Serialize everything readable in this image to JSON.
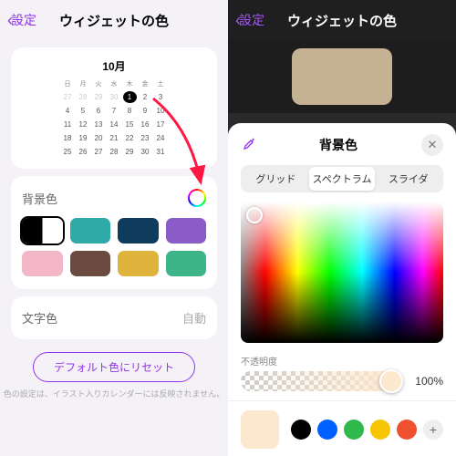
{
  "left": {
    "back": "設定",
    "title": "ウィジェットの色",
    "calendar": {
      "month": "10月",
      "dow": [
        "日",
        "月",
        "火",
        "水",
        "木",
        "金",
        "土"
      ],
      "prevDays": [
        27,
        28,
        29,
        30
      ],
      "days": [
        1,
        2,
        3,
        4,
        5,
        6,
        7,
        8,
        9,
        10,
        11,
        12,
        13,
        14,
        15,
        16,
        17,
        18,
        19,
        20,
        21,
        22,
        23,
        24,
        25,
        26,
        27,
        28,
        29,
        30,
        31
      ],
      "today": 1
    },
    "bgSection": {
      "title": "背景色"
    },
    "swatches": [
      "#30a9a9",
      "#0f3b5c",
      "#8b5cc7",
      "#f2b6c6",
      "#6b4a3f",
      "#e0b33c",
      "#3eb489"
    ],
    "textSection": {
      "title": "文字色",
      "value": "自動"
    },
    "reset": "デフォルト色にリセット",
    "note": "色の設定は、イラスト入りカレンダーには反映されません。"
  },
  "right": {
    "back": "設定",
    "title": "ウィジェットの色",
    "sheetTitle": "背景色",
    "tabs": [
      "グリッド",
      "スペクトラム",
      "スライダ"
    ],
    "activeTab": 1,
    "opacityLabel": "不透明度",
    "opacityValue": "100%",
    "currentColor": "#fce8ce",
    "presets": [
      "#000",
      "#0060ff",
      "#2fb84c",
      "#f7c400",
      "#f05030"
    ]
  }
}
